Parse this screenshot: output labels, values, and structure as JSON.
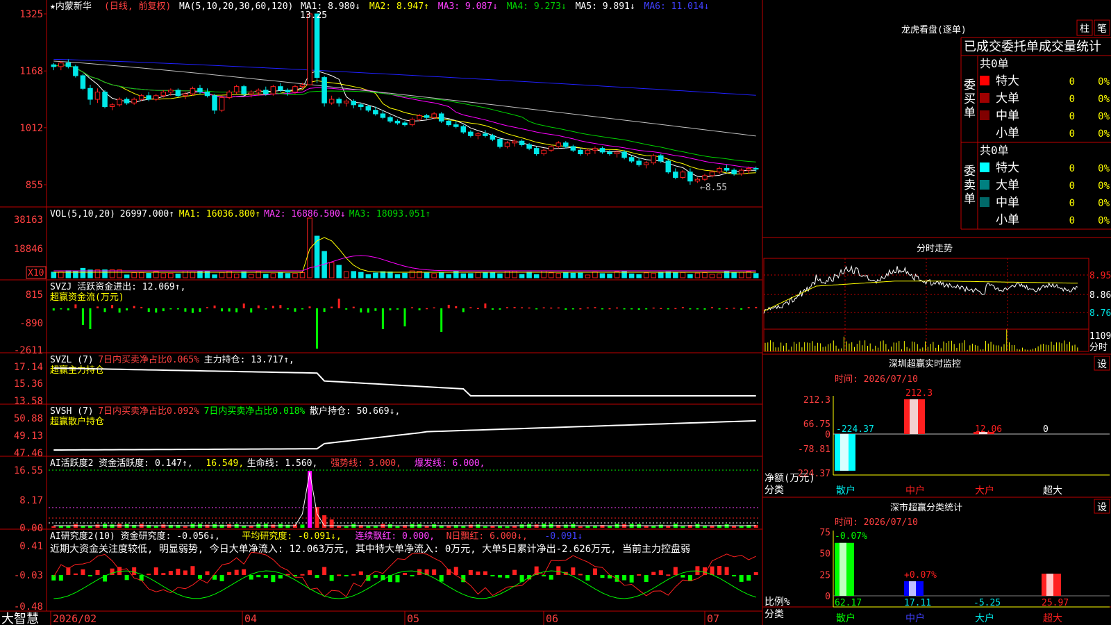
{
  "colors": {
    "up": "#ff2020",
    "down": "#00e8e8",
    "ma1": "#ffffff",
    "ma2": "#ffff00",
    "ma3": "#ff00ff",
    "ma4": "#00d000",
    "ma5": "#c0c0c0",
    "ma6": "#2020ff",
    "frame": "#c00000",
    "label": "#ff4040",
    "yellow": "#ffff00",
    "green": "#00ff00",
    "white": "#ffffff",
    "magenta": "#ff40ff"
  },
  "brand": "大智慧",
  "chart_data": {
    "type": "candlestick",
    "stock_title": "★内蒙新华",
    "period_tag": "(日线, 前复权)",
    "ma_spec": "MA(5,10,20,30,60,120)",
    "ma_values": [
      {
        "label": "MA1: 8.980↓",
        "color": "#ffffff"
      },
      {
        "label": "MA2: 8.947↑",
        "color": "#ffff00"
      },
      {
        "label": "MA3: 9.087↓",
        "color": "#ff40ff"
      },
      {
        "label": "MA4: 9.273↓",
        "color": "#00d000"
      },
      {
        "label": "MA5: 9.891↓",
        "color": "#ffffff"
      },
      {
        "label": "MA6: 11.014↓",
        "color": "#4040ff"
      }
    ],
    "y_ticks": [
      "1325",
      "1168",
      "1012",
      "855"
    ],
    "high_label": "13.25",
    "low_label": "←8.55",
    "x_labels": [
      "2026/02",
      "04",
      "05",
      "06",
      "07"
    ],
    "candles": [
      [
        11.85,
        11.9,
        11.7,
        11.8
      ],
      [
        11.8,
        11.95,
        11.7,
        11.9
      ],
      [
        11.9,
        12.0,
        11.75,
        11.8
      ],
      [
        11.8,
        11.85,
        11.5,
        11.55
      ],
      [
        11.55,
        11.6,
        11.15,
        11.2
      ],
      [
        11.2,
        11.3,
        10.75,
        10.9
      ],
      [
        10.9,
        11.2,
        10.8,
        11.1
      ],
      [
        11.1,
        11.15,
        10.65,
        10.7
      ],
      [
        10.7,
        10.8,
        10.6,
        10.75
      ],
      [
        10.75,
        10.95,
        10.7,
        10.9
      ],
      [
        10.9,
        10.95,
        10.75,
        10.8
      ],
      [
        10.8,
        10.95,
        10.75,
        10.9
      ],
      [
        10.9,
        11.05,
        10.85,
        11.0
      ],
      [
        11.0,
        11.1,
        10.85,
        10.9
      ],
      [
        10.9,
        11.05,
        10.85,
        11.0
      ],
      [
        11.0,
        11.15,
        10.95,
        11.1
      ],
      [
        11.1,
        11.2,
        11.0,
        11.15
      ],
      [
        11.15,
        11.2,
        10.95,
        11.0
      ],
      [
        11.0,
        11.1,
        10.9,
        11.05
      ],
      [
        11.05,
        11.25,
        11.0,
        11.2
      ],
      [
        11.2,
        11.3,
        11.05,
        11.1
      ],
      [
        11.1,
        11.2,
        10.95,
        11.0
      ],
      [
        11.0,
        11.05,
        10.5,
        10.6
      ],
      [
        10.6,
        11.0,
        10.55,
        10.95
      ],
      [
        10.95,
        11.15,
        10.9,
        11.1
      ],
      [
        11.1,
        11.3,
        11.05,
        11.25
      ],
      [
        11.25,
        11.3,
        11.0,
        11.05
      ],
      [
        11.05,
        11.15,
        10.95,
        11.1
      ],
      [
        11.1,
        11.2,
        11.0,
        11.15
      ],
      [
        11.15,
        11.25,
        11.0,
        11.05
      ],
      [
        11.05,
        11.3,
        11.0,
        11.25
      ],
      [
        11.25,
        11.35,
        11.1,
        11.15
      ],
      [
        11.15,
        11.2,
        11.0,
        11.1
      ],
      [
        11.1,
        11.3,
        11.05,
        11.25
      ],
      [
        11.25,
        11.35,
        11.2,
        11.3
      ],
      [
        11.3,
        13.25,
        11.3,
        13.25
      ],
      [
        13.25,
        13.25,
        11.35,
        11.5
      ],
      [
        11.5,
        11.55,
        10.7,
        10.8
      ],
      [
        10.8,
        11.0,
        10.75,
        10.9
      ],
      [
        10.9,
        10.95,
        10.7,
        10.8
      ],
      [
        10.8,
        10.9,
        10.7,
        10.85
      ],
      [
        10.85,
        10.9,
        10.65,
        10.75
      ],
      [
        10.75,
        10.8,
        10.6,
        10.7
      ],
      [
        10.7,
        10.75,
        10.55,
        10.6
      ],
      [
        10.6,
        10.7,
        10.45,
        10.5
      ],
      [
        10.5,
        10.6,
        10.35,
        10.4
      ],
      [
        10.4,
        10.45,
        10.25,
        10.3
      ],
      [
        10.3,
        10.35,
        10.2,
        10.25
      ],
      [
        10.25,
        10.3,
        10.15,
        10.2
      ],
      [
        10.2,
        10.4,
        10.15,
        10.35
      ],
      [
        10.35,
        10.5,
        10.3,
        10.45
      ],
      [
        10.45,
        10.5,
        10.35,
        10.4
      ],
      [
        10.4,
        10.55,
        10.35,
        10.5
      ],
      [
        10.5,
        10.55,
        10.25,
        10.3
      ],
      [
        10.3,
        10.35,
        10.15,
        10.2
      ],
      [
        10.2,
        10.3,
        10.1,
        10.15
      ],
      [
        10.15,
        10.2,
        9.95,
        10.0
      ],
      [
        10.0,
        10.05,
        9.85,
        9.9
      ],
      [
        9.9,
        10.0,
        9.8,
        9.95
      ],
      [
        9.95,
        10.05,
        9.85,
        9.9
      ],
      [
        9.9,
        9.95,
        9.75,
        9.8
      ],
      [
        9.8,
        9.85,
        9.55,
        9.6
      ],
      [
        9.6,
        9.75,
        9.55,
        9.7
      ],
      [
        9.7,
        9.8,
        9.6,
        9.75
      ],
      [
        9.75,
        9.8,
        9.6,
        9.65
      ],
      [
        9.65,
        9.7,
        9.5,
        9.55
      ],
      [
        9.55,
        9.6,
        9.35,
        9.4
      ],
      [
        9.4,
        9.55,
        9.35,
        9.5
      ],
      [
        9.5,
        9.65,
        9.45,
        9.6
      ],
      [
        9.6,
        9.75,
        9.55,
        9.7
      ],
      [
        9.7,
        9.75,
        9.55,
        9.6
      ],
      [
        9.6,
        9.65,
        9.45,
        9.5
      ],
      [
        9.5,
        9.55,
        9.35,
        9.4
      ],
      [
        9.4,
        9.55,
        9.35,
        9.5
      ],
      [
        9.5,
        9.6,
        9.4,
        9.55
      ],
      [
        9.55,
        9.6,
        9.4,
        9.45
      ],
      [
        9.45,
        9.5,
        9.35,
        9.4
      ],
      [
        9.4,
        9.5,
        9.3,
        9.45
      ],
      [
        9.45,
        9.5,
        9.25,
        9.3
      ],
      [
        9.3,
        9.35,
        9.15,
        9.2
      ],
      [
        9.2,
        9.3,
        9.05,
        9.1
      ],
      [
        9.1,
        9.2,
        9.0,
        9.15
      ],
      [
        9.15,
        9.4,
        9.1,
        9.35
      ],
      [
        9.35,
        9.4,
        9.15,
        9.2
      ],
      [
        9.2,
        9.25,
        8.85,
        8.9
      ],
      [
        8.9,
        9.0,
        8.7,
        8.75
      ],
      [
        8.75,
        8.95,
        8.7,
        8.9
      ],
      [
        8.9,
        9.0,
        8.55,
        8.65
      ],
      [
        8.65,
        8.75,
        8.6,
        8.7
      ],
      [
        8.7,
        8.85,
        8.65,
        8.8
      ],
      [
        8.8,
        8.95,
        8.75,
        8.9
      ],
      [
        8.9,
        9.05,
        8.85,
        9.0
      ],
      [
        9.0,
        9.1,
        8.9,
        8.95
      ],
      [
        8.95,
        9.0,
        8.8,
        8.85
      ],
      [
        8.85,
        9.0,
        8.8,
        8.95
      ],
      [
        8.95,
        9.05,
        8.85,
        9.0
      ],
      [
        9.0,
        9.05,
        8.9,
        8.98
      ]
    ],
    "panels": [
      {
        "name": "VOL",
        "title": "VOL(5,10,20)",
        "value": "26997.000↑",
        "ticks": [
          "38163",
          "18846"
        ],
        "extra": "X10",
        "items": [
          {
            "text": "MA1: 16036.800↑",
            "color": "#ffff00"
          },
          {
            "text": "MA2: 16886.500↓",
            "color": "#ff40ff"
          },
          {
            "text": "MA3: 18093.051↑",
            "color": "#00d000"
          }
        ]
      },
      {
        "name": "SVZJ",
        "title": "SVZJ  活跃资金进出: 12.069↑,",
        "subtitle": "超赢资金流(万元)",
        "ticks": [
          "815",
          "-890",
          "-2611"
        ]
      },
      {
        "name": "SVZL",
        "title": "SVZL (7)",
        "items": [
          {
            "text": "7日内买卖净占比0.065%",
            "color": "#ff4040"
          },
          {
            "text": "主力持仓: 13.717↑,",
            "color": "#ffffff"
          }
        ],
        "subtitle": "超赢主力持仓",
        "ticks": [
          "17.14",
          "15.36",
          "13.58"
        ]
      },
      {
        "name": "SVSH",
        "title": "SVSH (7)",
        "items": [
          {
            "text": "7日内买卖净占比0.092%",
            "color": "#ff4040"
          },
          {
            "text": "7日内买卖净占比0.018%",
            "color": "#00ff00"
          },
          {
            "text": "散户持仓: 50.669↓,",
            "color": "#ffffff"
          }
        ],
        "subtitle": "超赢散户持仓",
        "ticks": [
          "50.88",
          "49.13",
          "47.46"
        ]
      },
      {
        "name": "AIACT",
        "title": "AI活跃度2 资金活跃度: 0.147↑,",
        "items": [
          {
            "text": "16.549,",
            "color": "#ffff00"
          },
          {
            "text": "生命线: 1.560,",
            "color": "#ffffff"
          },
          {
            "text": "强势线: 3.000,",
            "color": "#ff4040"
          },
          {
            "text": "爆发线: 6.000,",
            "color": "#ff40ff"
          }
        ],
        "ticks": [
          "16.55",
          "8.17",
          "0.00"
        ]
      },
      {
        "name": "AIRES",
        "title": "AI研究度2(10) 资金研究度: -0.056↓,",
        "items": [
          {
            "text": "平均研究度: -0.091↓,",
            "color": "#ffff00"
          },
          {
            "text": "连续飘红: 0.000,",
            "color": "#ff40ff"
          },
          {
            "text": "N日飘红: 6.000↓,",
            "color": "#ff4040"
          },
          {
            "text": "-0.091↓",
            "color": "#4040ff"
          }
        ],
        "desc": "近期大资金关注度较低, 明显弱势, 今日大单净流入: 12.063万元, 其中特大单净流入: 0万元, 大单5日累计净出-2.626万元, 当前主力控盘弱",
        "ticks": [
          "0.41",
          "-0.03",
          "-0.48"
        ]
      }
    ]
  },
  "right": {
    "dragon_title": "龙虎看盘(逐单)",
    "btn_zhu": "柱",
    "btn_bi": "笔",
    "stats_title": "已成交委托单成交量统计",
    "buy_label": "委买单",
    "sell_label": "委卖单",
    "total_buy": "共0单",
    "total_sell": "共0单",
    "buy_rows": [
      {
        "name": "特大",
        "count": "0",
        "pct": "0%",
        "color": "#ff0000"
      },
      {
        "name": "大单",
        "count": "0",
        "pct": "0%",
        "color": "#a00000"
      },
      {
        "name": "中单",
        "count": "0",
        "pct": "0%",
        "color": "#800000"
      },
      {
        "name": "小单",
        "count": "0",
        "pct": "0%",
        "color": "#000000"
      }
    ],
    "sell_rows": [
      {
        "name": "特大",
        "count": "0",
        "pct": "0%",
        "color": "#00ffff"
      },
      {
        "name": "大单",
        "count": "0",
        "pct": "0%",
        "color": "#008080"
      },
      {
        "name": "中单",
        "count": "0",
        "pct": "0%",
        "color": "#006868"
      },
      {
        "name": "小单",
        "count": "0",
        "pct": "0%",
        "color": "#000000"
      }
    ],
    "intraday_title": "分时走势",
    "intraday_ticks": [
      "8.95",
      "8.86",
      "8.76"
    ],
    "intraday_vol": "1109",
    "intraday_vol_label": "分时",
    "monitor_title": "深圳超赢实时监控",
    "monitor_btn": "设",
    "monitor_time": "时间: 2026/07/10",
    "monitor_ticks": [
      "212.3",
      "66.75",
      "0",
      "-78.81",
      "-224.37"
    ],
    "monitor_ylabel": "净额(万元)",
    "monitor_xlabel": "分类",
    "monitor_cats": [
      "散户",
      "中户",
      "大户",
      "超大"
    ],
    "monitor_values": [
      -224.37,
      212.3,
      12.06,
      0
    ],
    "monitor_value_labels": [
      "-224.37",
      "212.3",
      "12.06",
      "0"
    ],
    "classify_title": "深市超赢分类统计",
    "classify_btn": "设",
    "classify_time": "时间: 2026/07/10",
    "classify_ticks": [
      "75",
      "50",
      "25",
      "0"
    ],
    "classify_ylabel": "比例%",
    "classify_xlabel": "分类",
    "classify_cats": [
      "散户",
      "中户",
      "大户",
      "超大"
    ],
    "classify_values": [
      62.17,
      17.11,
      -5.25,
      25.97
    ],
    "classify_value_labels": [
      "62.17",
      "17.11",
      "-5.25",
      "25.97"
    ],
    "classify_top_labels": [
      "-0.07%",
      "+0.07%"
    ]
  }
}
